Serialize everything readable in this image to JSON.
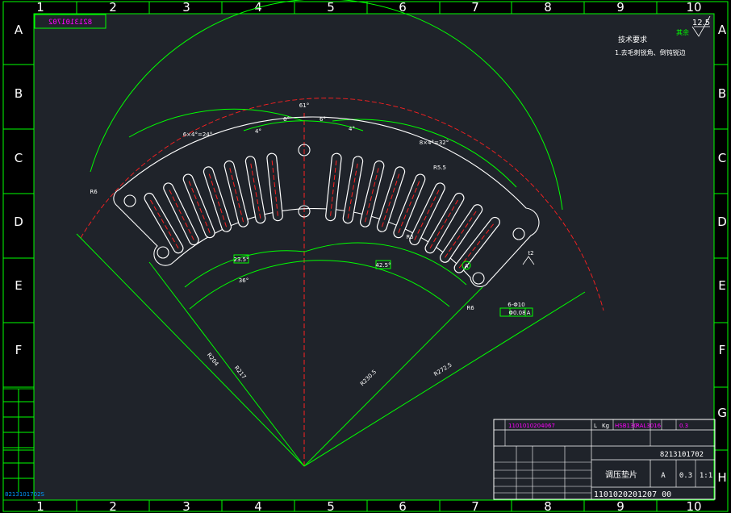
{
  "frame": {
    "col_labels": [
      "1",
      "2",
      "3",
      "4",
      "5",
      "6",
      "7",
      "8",
      "9",
      "10"
    ],
    "row_labels": [
      "A",
      "B",
      "C",
      "D",
      "E",
      "F",
      "G",
      "H"
    ]
  },
  "corner_code": "8213101702",
  "surface_finish": "12.5",
  "surface_note": "其余",
  "tech": {
    "title": "技术要求",
    "line1": "1.去毛刺锐角、倒钝锐边"
  },
  "dims": {
    "total_angle": "61°",
    "left_pattern": "6×4°=24°",
    "right_pattern": "8×4°=32°",
    "pitch_l": "4°",
    "pitch_r": "4°",
    "half_l": "6°",
    "half_r": "6°",
    "r_left": "R6",
    "r_right": "R6",
    "r_slot": "R5.5",
    "r_slot_inner": "R5",
    "ang_left": "23.5°",
    "ang_right": "42.5°",
    "ang_bottom": "36°",
    "r1": "R204",
    "r2": "R217",
    "r3": "R230.5",
    "r4": "R272.5",
    "hole": "6-Φ10",
    "tol": "Φ0.08",
    "datum": "A",
    "t": "t2"
  },
  "title_block": {
    "material_row": "1101010204067",
    "mat_name": "HSB130",
    "mat_code": "RAL3016",
    "kg": "Kg",
    "qty_l": "L",
    "thick": "0.3",
    "drawing_no": "8213101702",
    "part_name": "调压垫片",
    "scale_lbl": "A",
    "weight": "0.3",
    "scale": "1:1",
    "code_bottom": "1101020201207 00"
  },
  "left_strip": {
    "bottom_code": "8213101702S"
  }
}
